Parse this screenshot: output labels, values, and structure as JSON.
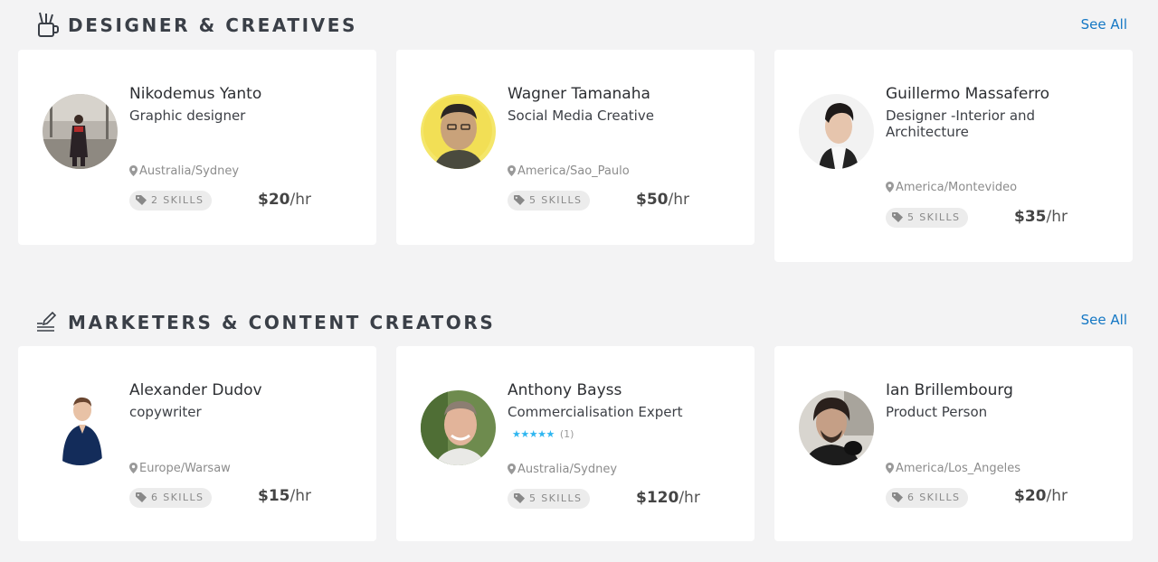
{
  "sections": [
    {
      "title": "DESIGNER & CREATIVES",
      "icon": "pencil-cup-icon",
      "see_all": "See All",
      "cards": [
        {
          "name": "Nikodemus Yanto",
          "role": "Graphic designer",
          "location": "Australia/Sydney",
          "skills": "2 SKILLS",
          "rate": "$20",
          "rate_unit": "/hr"
        },
        {
          "name": "Wagner Tamanaha",
          "role": "Social Media Creative",
          "location": "America/Sao_Paulo",
          "skills": "5 SKILLS",
          "rate": "$50",
          "rate_unit": "/hr"
        },
        {
          "name": "Guillermo Massaferro",
          "role": "Designer -Interior and Architecture",
          "location": "America/Montevideo",
          "skills": "5 SKILLS",
          "rate": "$35",
          "rate_unit": "/hr"
        }
      ]
    },
    {
      "title": "MARKETERS & CONTENT CREATORS",
      "icon": "writing-icon",
      "see_all": "See All",
      "cards": [
        {
          "name": "Alexander Dudov",
          "role": "copywriter",
          "location": "Europe/Warsaw",
          "skills": "6 SKILLS",
          "rate": "$15",
          "rate_unit": "/hr"
        },
        {
          "name": "Anthony Bayss",
          "role": "Commercialisation Expert",
          "rating_stars": "★★★★★",
          "rating_count": "(1)",
          "location": "Australia/Sydney",
          "skills": "5 SKILLS",
          "rate": "$120",
          "rate_unit": "/hr"
        },
        {
          "name": "Ian Brillembourg",
          "role": "Product Person",
          "location": "America/Los_Angeles",
          "skills": "6 SKILLS",
          "rate": "$20",
          "rate_unit": "/hr"
        }
      ]
    }
  ],
  "colors": {
    "accent_link": "#1477c4",
    "star": "#2fb6f0",
    "page_bg": "#f3f3f4"
  },
  "icons": {
    "location": "map-pin-icon",
    "skills": "tag-icon"
  }
}
